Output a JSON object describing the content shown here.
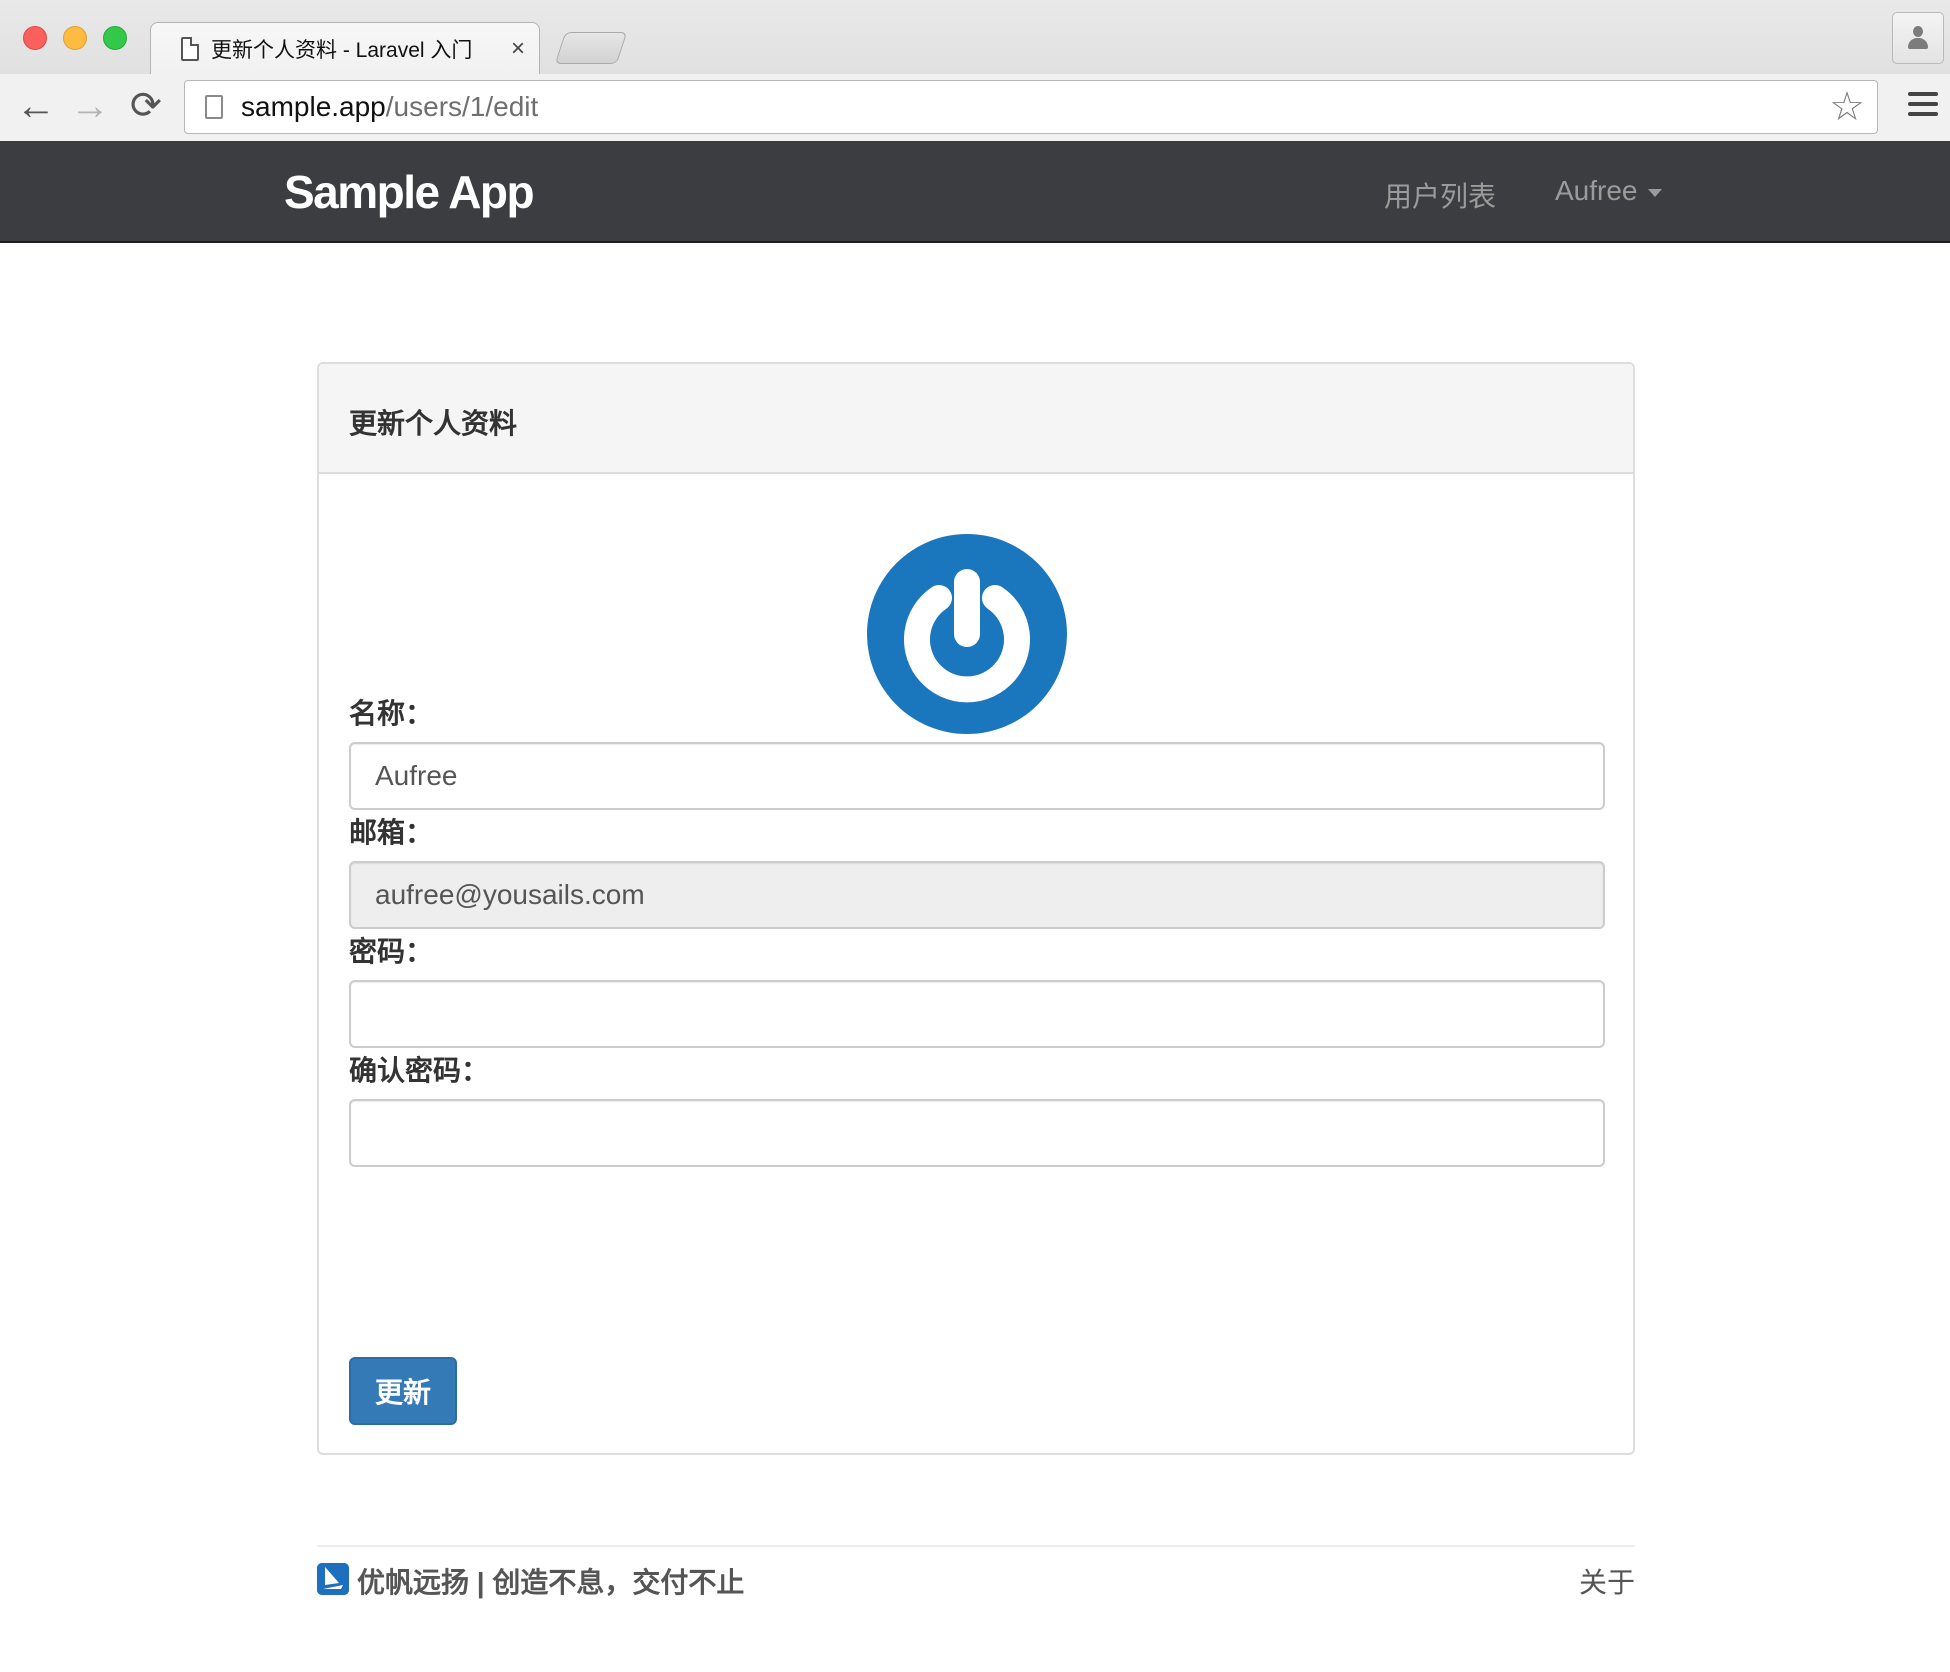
{
  "browser": {
    "tab_title": "更新个人资料 - Laravel 入门",
    "tab_close": "×",
    "url_host": "sample.app",
    "url_path": "/users/1/edit",
    "back_glyph": "←",
    "forward_glyph": "→",
    "reload_glyph": "⟳",
    "star_glyph": "☆"
  },
  "navbar": {
    "brand": "Sample App",
    "users_link": "用户列表",
    "user_menu": "Aufree",
    "bg_color": "#3c3d40"
  },
  "panel": {
    "title": "更新个人资料",
    "avatar_icon": "gravatar-power-icon",
    "fields": {
      "name_label": "名称：",
      "name_value": "Aufree",
      "email_label": "邮箱：",
      "email_value": "aufree@yousails.com",
      "password_label": "密码：",
      "password_value": "",
      "confirm_label": "确认密码：",
      "confirm_value": ""
    },
    "submit_label": "更新",
    "accent_color": "#337ab7"
  },
  "footer": {
    "company": "优帆远扬 | 创造不息，交付不止",
    "about": "关于"
  }
}
